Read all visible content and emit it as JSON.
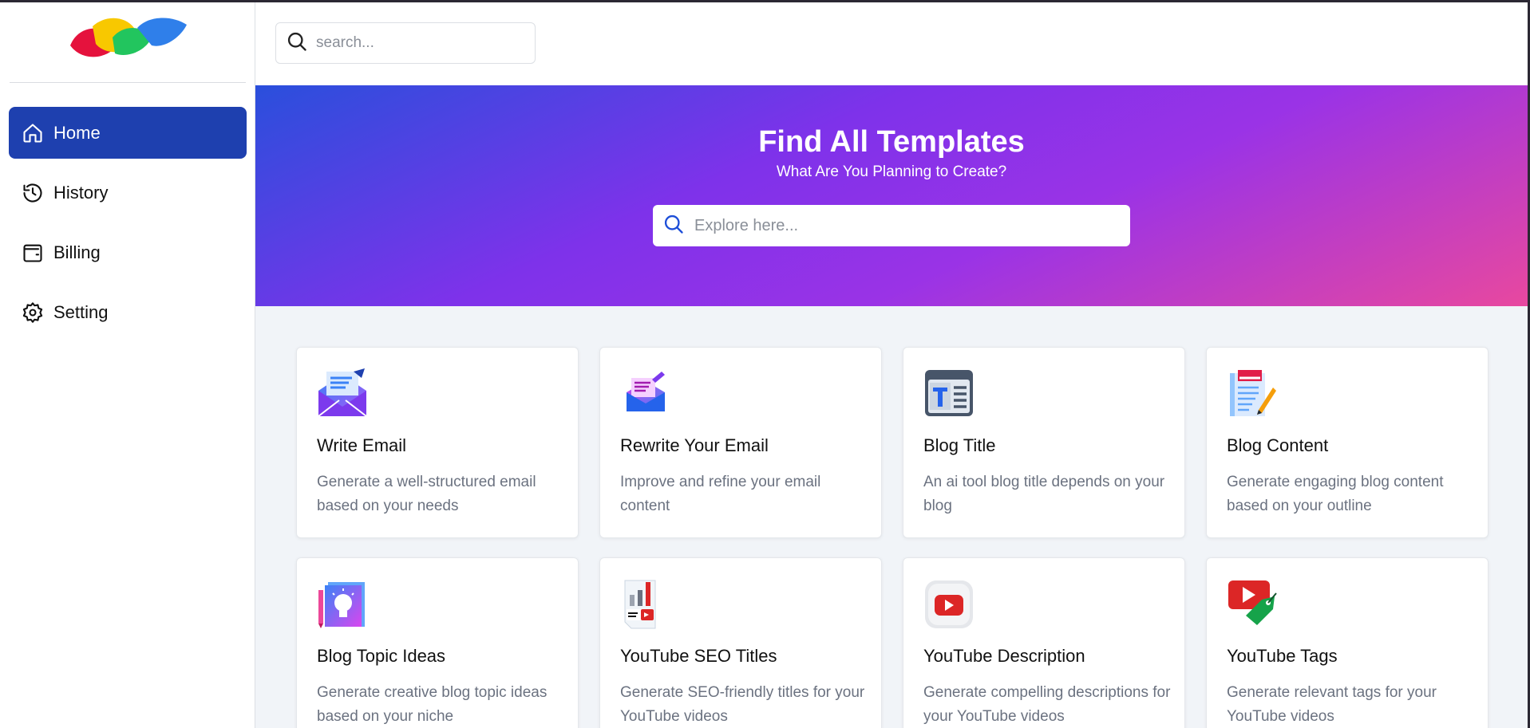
{
  "sidebar": {
    "logo_name": "app-logo",
    "items": [
      {
        "label": "Home",
        "icon": "home-icon",
        "active": true
      },
      {
        "label": "History",
        "icon": "history-icon",
        "active": false
      },
      {
        "label": "Billing",
        "icon": "wallet-icon",
        "active": false
      },
      {
        "label": "Setting",
        "icon": "gear-icon",
        "active": false
      }
    ]
  },
  "topbar": {
    "search_placeholder": "search..."
  },
  "hero": {
    "title": "Find All Templates",
    "subtitle": "What Are You Planning to Create?",
    "search_placeholder": "Explore here..."
  },
  "templates": [
    {
      "title": "Write Email",
      "description": "Generate a well-structured email based on your needs",
      "icon": "email-envelope-icon"
    },
    {
      "title": "Rewrite Your Email",
      "description": "Improve and refine your email content",
      "icon": "email-edit-icon"
    },
    {
      "title": "Blog Title",
      "description": "An ai tool blog title depends on your blog",
      "icon": "blog-title-icon"
    },
    {
      "title": "Blog Content",
      "description": "Generate engaging blog content based on your outline",
      "icon": "blog-content-icon"
    },
    {
      "title": "Blog Topic Ideas",
      "description": "Generate creative blog topic ideas based on your niche",
      "icon": "lightbulb-idea-icon"
    },
    {
      "title": "YouTube SEO Titles",
      "description": "Generate SEO-friendly titles for your YouTube videos",
      "icon": "youtube-seo-icon"
    },
    {
      "title": "YouTube Description",
      "description": "Generate compelling descriptions for your YouTube videos",
      "icon": "youtube-play-icon"
    },
    {
      "title": "YouTube Tags",
      "description": "Generate relevant tags for your YouTube videos",
      "icon": "youtube-tag-icon"
    }
  ],
  "colors": {
    "active_nav": "#1e40af",
    "hero_gradient_start": "#2a4fdc",
    "hero_gradient_mid": "#9a33e6",
    "hero_gradient_end": "#e8489f",
    "main_bg": "#f1f4f8"
  }
}
